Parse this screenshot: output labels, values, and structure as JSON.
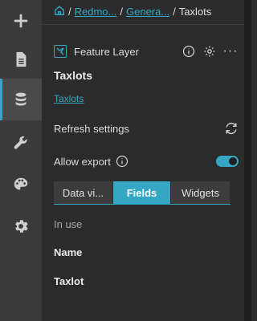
{
  "rail": {
    "items": [
      {
        "icon": "plus-icon",
        "active": false
      },
      {
        "icon": "page-icon",
        "active": false
      },
      {
        "icon": "database-icon",
        "active": true
      },
      {
        "icon": "wrench-icon",
        "active": false
      },
      {
        "icon": "palette-icon",
        "active": false
      },
      {
        "icon": "gear-icon",
        "active": false
      }
    ]
  },
  "breadcrumb": {
    "home_icon": "home-icon",
    "sep": "/",
    "items": [
      "Redmo...",
      "Genera...",
      "Taxlots"
    ]
  },
  "layer": {
    "type_label": "Feature Layer",
    "name": "Taxlots",
    "link_text": "Taxlots",
    "more_label": "···"
  },
  "settings": {
    "refresh_label": "Refresh settings",
    "export_label": "Allow export",
    "export_enabled": true
  },
  "tabs": [
    {
      "label": "Data vi...",
      "active": false
    },
    {
      "label": "Fields",
      "active": true
    },
    {
      "label": "Widgets",
      "active": false
    }
  ],
  "fields": {
    "section_label": "In use",
    "items": [
      "Name",
      "Taxlot"
    ]
  },
  "colors": {
    "accent": "#35a7c4",
    "background": "#2b2b2b",
    "rail": "#3a3a3a"
  }
}
